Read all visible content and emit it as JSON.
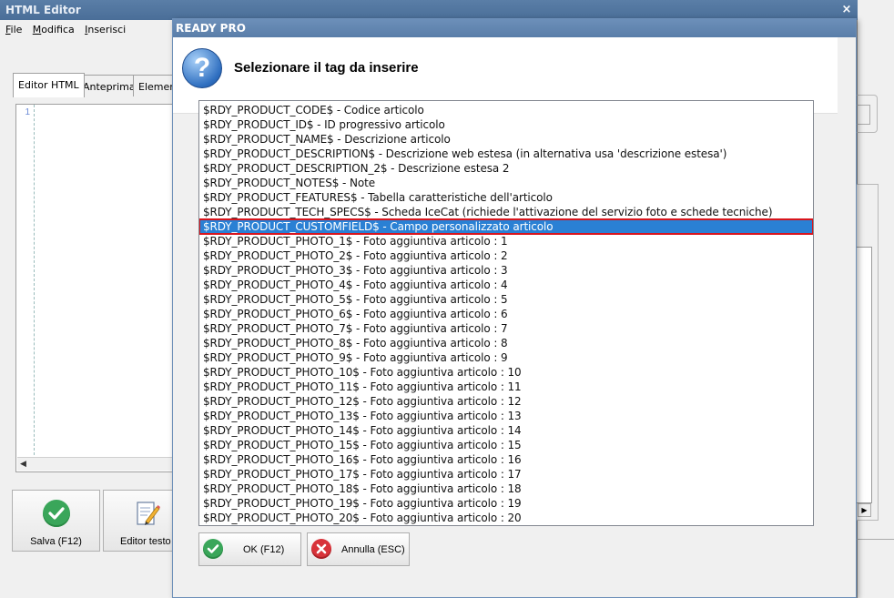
{
  "editor": {
    "title": "HTML Editor",
    "close_glyph": "×",
    "menu": [
      {
        "label": "File",
        "accel": "F"
      },
      {
        "label": "Modifica",
        "accel": "M"
      },
      {
        "label": "Inserisci",
        "accel": "I"
      }
    ],
    "tabs": [
      "Editor HTML",
      "Anteprima",
      "Elementi"
    ],
    "active_tab": "Editor HTML",
    "line_number": "1",
    "buttons": {
      "save_label": "Salva (F12)",
      "text_editor_label": "Editor testo"
    },
    "icons": {
      "save": "check-circle-icon",
      "text_editor": "edit-document-icon"
    }
  },
  "dialog": {
    "title": "READY PRO",
    "heading": "Selezionare il tag da inserire",
    "icon": "question-icon",
    "selected_index": 8,
    "tags": [
      "$RDY_PRODUCT_CODE$ - Codice articolo",
      "$RDY_PRODUCT_ID$ - ID progressivo articolo",
      "$RDY_PRODUCT_NAME$ - Descrizione articolo",
      "$RDY_PRODUCT_DESCRIPTION$ - Descrizione web estesa (in alternativa usa 'descrizione estesa')",
      "$RDY_PRODUCT_DESCRIPTION_2$ - Descrizione estesa 2",
      "$RDY_PRODUCT_NOTES$ - Note",
      "$RDY_PRODUCT_FEATURES$ - Tabella caratteristiche dell'articolo",
      "$RDY_PRODUCT_TECH_SPECS$ - Scheda IceCat (richiede l'attivazione del servizio foto e schede tecniche)",
      "$RDY_PRODUCT_CUSTOMFIELD$ - Campo personalizzato articolo",
      "$RDY_PRODUCT_PHOTO_1$ - Foto aggiuntiva articolo : 1",
      "$RDY_PRODUCT_PHOTO_2$ - Foto aggiuntiva articolo : 2",
      "$RDY_PRODUCT_PHOTO_3$ - Foto aggiuntiva articolo : 3",
      "$RDY_PRODUCT_PHOTO_4$ - Foto aggiuntiva articolo : 4",
      "$RDY_PRODUCT_PHOTO_5$ - Foto aggiuntiva articolo : 5",
      "$RDY_PRODUCT_PHOTO_6$ - Foto aggiuntiva articolo : 6",
      "$RDY_PRODUCT_PHOTO_7$ - Foto aggiuntiva articolo : 7",
      "$RDY_PRODUCT_PHOTO_8$ - Foto aggiuntiva articolo : 8",
      "$RDY_PRODUCT_PHOTO_9$ - Foto aggiuntiva articolo : 9",
      "$RDY_PRODUCT_PHOTO_10$ - Foto aggiuntiva articolo : 10",
      "$RDY_PRODUCT_PHOTO_11$ - Foto aggiuntiva articolo : 11",
      "$RDY_PRODUCT_PHOTO_12$ - Foto aggiuntiva articolo : 12",
      "$RDY_PRODUCT_PHOTO_13$ - Foto aggiuntiva articolo : 13",
      "$RDY_PRODUCT_PHOTO_14$ - Foto aggiuntiva articolo : 14",
      "$RDY_PRODUCT_PHOTO_15$ - Foto aggiuntiva articolo : 15",
      "$RDY_PRODUCT_PHOTO_16$ - Foto aggiuntiva articolo : 16",
      "$RDY_PRODUCT_PHOTO_17$ - Foto aggiuntiva articolo : 17",
      "$RDY_PRODUCT_PHOTO_18$ - Foto aggiuntiva articolo : 18",
      "$RDY_PRODUCT_PHOTO_19$ - Foto aggiuntiva articolo : 19",
      "$RDY_PRODUCT_PHOTO_20$ - Foto aggiuntiva articolo : 20"
    ],
    "buttons": {
      "ok_label": "OK (F12)",
      "cancel_label": "Annulla (ESC)"
    },
    "colors": {
      "selection_bg": "#2a80d4",
      "selection_outline": "#d8151d",
      "ok_green": "#3aa65a",
      "cancel_red": "#d8333a"
    }
  }
}
